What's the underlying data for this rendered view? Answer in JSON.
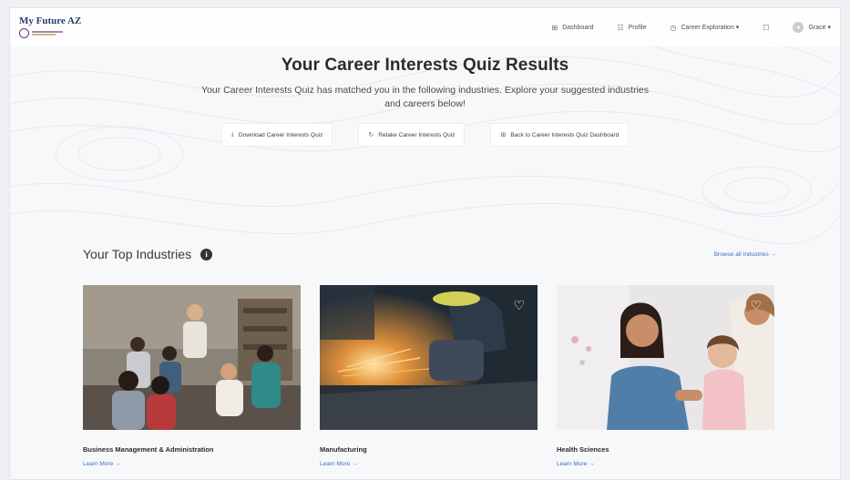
{
  "nav": {
    "logo_title": "My Future AZ",
    "items": [
      {
        "label": "Dashboard",
        "icon": "dashboard-icon",
        "glyph": "⊞"
      },
      {
        "label": "Profile",
        "icon": "profile-icon",
        "glyph": "☷"
      },
      {
        "label": "Career Exploration ▾",
        "icon": "career-icon",
        "glyph": "◷"
      }
    ],
    "user_name": "Grace ▾"
  },
  "hero": {
    "title": "Your Career Interests Quiz Results",
    "description": "Your Career Interests Quiz has matched you in the following industries. Explore your suggested industries and careers below!"
  },
  "actions": [
    {
      "label": "Download Career Interests Quiz",
      "icon": "download-icon",
      "glyph": "⤓"
    },
    {
      "label": "Retake Career Interests Quiz",
      "icon": "retake-icon",
      "glyph": "↻"
    },
    {
      "label": "Back to Career Interests Quiz Dashboard",
      "icon": "grid-icon",
      "glyph": "⊞"
    }
  ],
  "industries": {
    "heading": "Your Top Industries",
    "info_glyph": "i",
    "browse_label": "Browse all Industries →",
    "cards": [
      {
        "title": "Business Management & Administration",
        "learn_more": "Learn More →"
      },
      {
        "title": "Manufacturing",
        "learn_more": "Learn More →"
      },
      {
        "title": "Health Sciences",
        "learn_more": "Learn More →"
      }
    ]
  },
  "colors": {
    "accent_link": "#3b6fd0",
    "logo_purple": "#6a3b7a",
    "logo_gold": "#b08a2e"
  }
}
